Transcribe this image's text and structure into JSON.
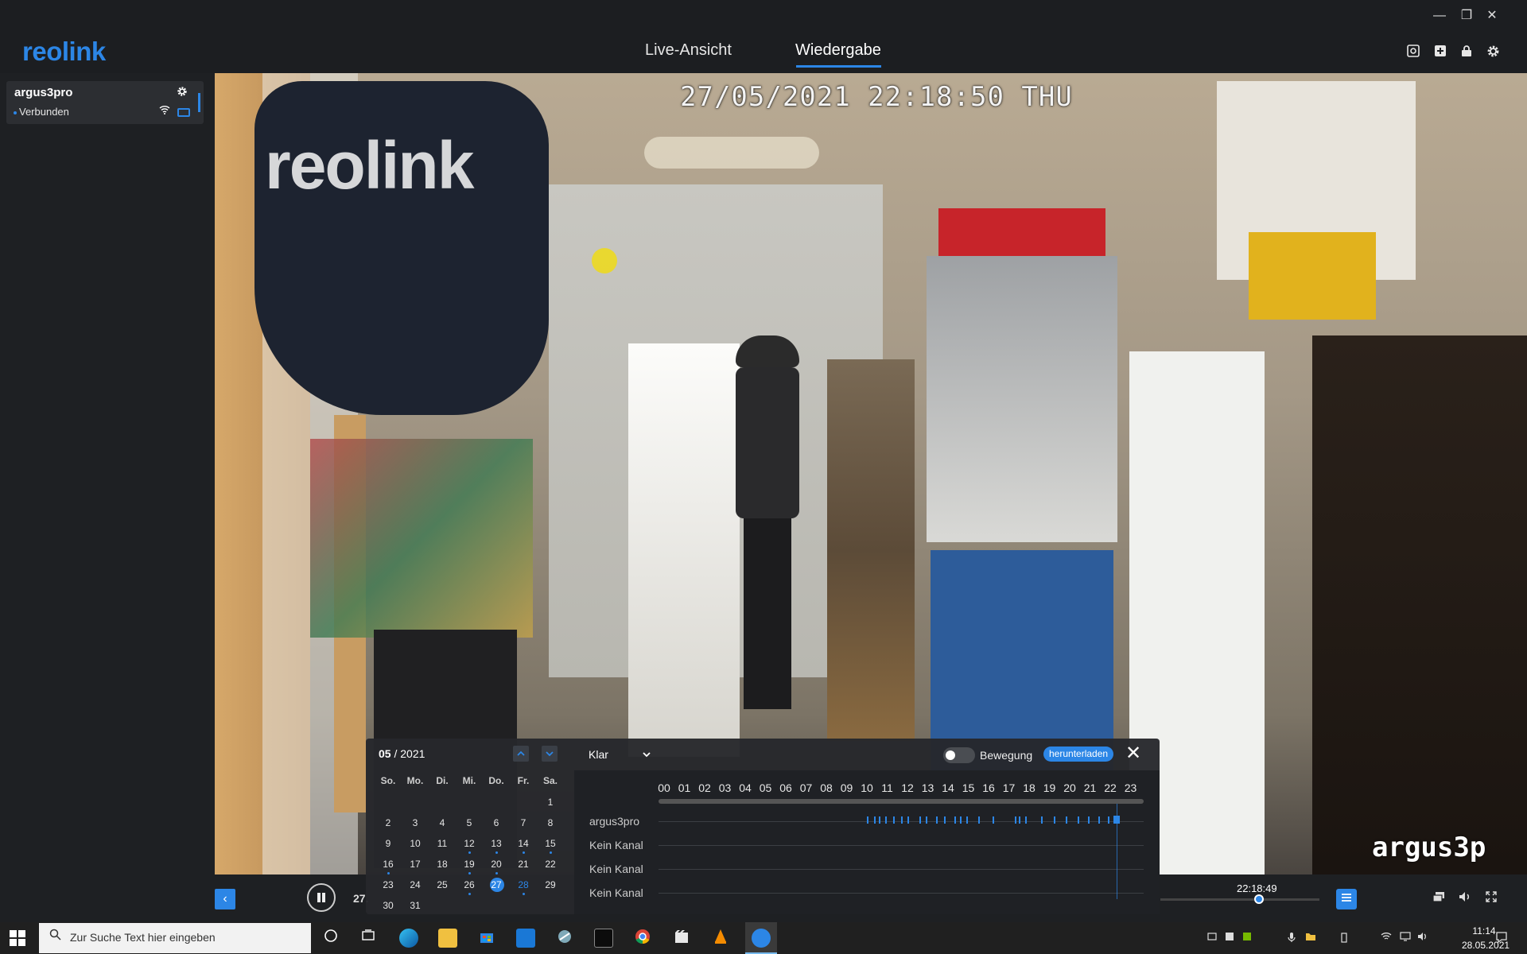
{
  "app": {
    "logo": "reolink",
    "tabs": [
      {
        "label": "Live-Ansicht"
      },
      {
        "label": "Wiedergabe"
      }
    ],
    "window_controls": {
      "minimize": "—",
      "restore": "❐",
      "close": "✕"
    },
    "toolbar_icons": [
      "screenshot-icon",
      "add-icon",
      "lock-icon",
      "gear-icon"
    ]
  },
  "sidebar": {
    "camera": {
      "name": "argus3pro",
      "status": "Verbunden"
    }
  },
  "video": {
    "osd_timestamp": "27/05/2021 22:18:50 THU",
    "watermark_logo": "reolink",
    "watermark_camera": "argus3p"
  },
  "controls": {
    "collapse_label": "‹",
    "date_partial": "27.",
    "time_readout": "22:18:49",
    "scrub_position": 0.62
  },
  "calendar": {
    "month": "05",
    "year": "/ 2021",
    "weekdays": [
      "So.",
      "Mo.",
      "Di.",
      "Mi.",
      "Do.",
      "Fr.",
      "Sa."
    ],
    "first_weekday_index": 6,
    "days_in_month": 31,
    "selected_day": 27,
    "highlight_days": [
      28
    ],
    "recording_days": [
      12,
      13,
      14,
      15,
      16,
      19,
      20,
      26,
      28
    ]
  },
  "playback": {
    "quality": "Klar",
    "motion_label": "Bewegung",
    "download_label": "herunterladen",
    "close_label": "✕",
    "hours": [
      "00",
      "01",
      "02",
      "03",
      "04",
      "05",
      "06",
      "07",
      "08",
      "09",
      "10",
      "11",
      "12",
      "13",
      "14",
      "15",
      "16",
      "17",
      "18",
      "19",
      "20",
      "21",
      "22",
      "23"
    ],
    "channels": [
      "argus3pro",
      "Kein Kanal",
      "Kein Kanal",
      "Kein Kanal"
    ],
    "recording_hours": [
      10.0,
      10.35,
      10.6,
      10.9,
      11.3,
      11.7,
      12.0,
      12.6,
      12.9,
      13.4,
      13.8,
      14.3,
      14.6,
      14.9,
      15.5,
      16.2,
      17.3,
      17.5,
      17.8,
      18.6,
      19.2,
      19.8,
      20.4,
      20.9,
      21.4,
      21.9
    ],
    "current_hour": 22.3
  },
  "taskbar": {
    "search_placeholder": "Zur Suche Text hier eingeben",
    "clock_time": "11:14",
    "clock_date": "28.05.2021"
  },
  "colors": {
    "accent": "#2c86e6",
    "background": "#1e2023",
    "panel": "#26282c"
  }
}
